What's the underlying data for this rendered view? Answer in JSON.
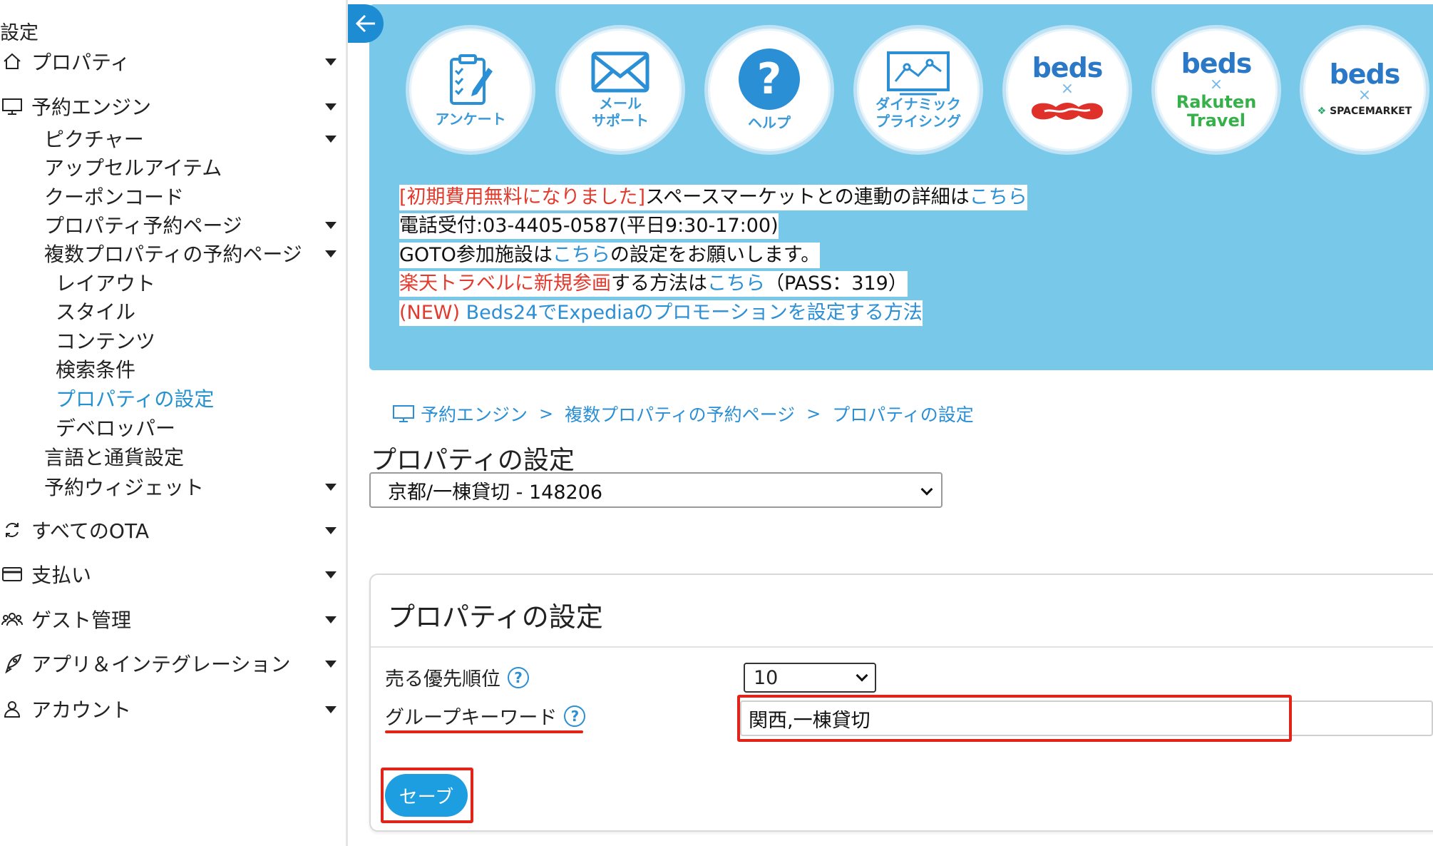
{
  "sidebar": {
    "title": "設定",
    "items": [
      {
        "label": "プロパティ",
        "icon": "home-icon"
      },
      {
        "label": "予約エンジン",
        "icon": "monitor-icon"
      },
      {
        "label": "ピクチャー"
      },
      {
        "label": "アップセルアイテム"
      },
      {
        "label": "クーポンコード"
      },
      {
        "label": "プロパティ予約ページ"
      },
      {
        "label": "複数プロパティの予約ページ"
      },
      {
        "label": "レイアウト"
      },
      {
        "label": "スタイル"
      },
      {
        "label": "コンテンツ"
      },
      {
        "label": "検索条件"
      },
      {
        "label": "プロパティの設定"
      },
      {
        "label": "デベロッパー"
      },
      {
        "label": "言語と通貨設定"
      },
      {
        "label": "予約ウィジェット"
      },
      {
        "label": "すべてのOTA",
        "icon": "sync-icon"
      },
      {
        "label": "支払い",
        "icon": "credit-card-icon"
      },
      {
        "label": "ゲスト管理",
        "icon": "users-icon"
      },
      {
        "label": "アプリ＆インテグレーション",
        "icon": "rocket-icon"
      },
      {
        "label": "アカウント",
        "icon": "user-icon"
      }
    ]
  },
  "banner": {
    "circles": [
      {
        "label": "アンケート",
        "icon": "clipboard-icon"
      },
      {
        "label": "メール\nサポート",
        "icon": "envelope-icon"
      },
      {
        "label": "ヘルプ",
        "icon": "question-icon"
      },
      {
        "label": "ダイナミック\nプライシング",
        "icon": "chart-icon"
      },
      {
        "brand": "beds",
        "x": "×",
        "partner": "jalan-logo"
      },
      {
        "brand": "beds",
        "x": "×",
        "partner_line1": "Rakuten",
        "partner_line2": "Travel"
      },
      {
        "brand": "beds",
        "x": "×",
        "partner_line1": "SPACEMARKET"
      }
    ],
    "lines": {
      "l1_red": "[初期費用無料になりました]",
      "l1_text": "スペースマーケットとの連動の詳細は",
      "l1_link": "こちら",
      "l2_text": "電話受付:03-4405-0587(平日9:30-17:00)",
      "l3_text1": "GOTO参加施設は",
      "l3_link": "こちら",
      "l3_text2": "の設定をお願いします。",
      "l4_red": "楽天トラベルに新規参画",
      "l4_text": "する方法は",
      "l4_link": "こちら",
      "l4_text2": "（PASS：319）",
      "l5_red": "(NEW)",
      "l5_link": " Beds24でExpediaのプロモーションを設定する方法"
    }
  },
  "breadcrumb": {
    "items": [
      "予約エンジン",
      "複数プロパティの予約ページ",
      "プロパティの設定"
    ],
    "sep": ">"
  },
  "page_title": "プロパティの設定",
  "property_select": {
    "value": "京都/一棟貸切 - 148206"
  },
  "panel": {
    "title": "プロパティの設定",
    "priority_label": "売る優先順位",
    "priority_value": "10",
    "keyword_label": "グループキーワード",
    "keyword_value": "関西,一棟貸切",
    "help_glyph": "?",
    "save_label": "セーブ"
  },
  "colors": {
    "accent": "#2a8fd5",
    "banner": "#78c8ea",
    "annotation": "#e0241a",
    "save": "#1d9ee0"
  }
}
